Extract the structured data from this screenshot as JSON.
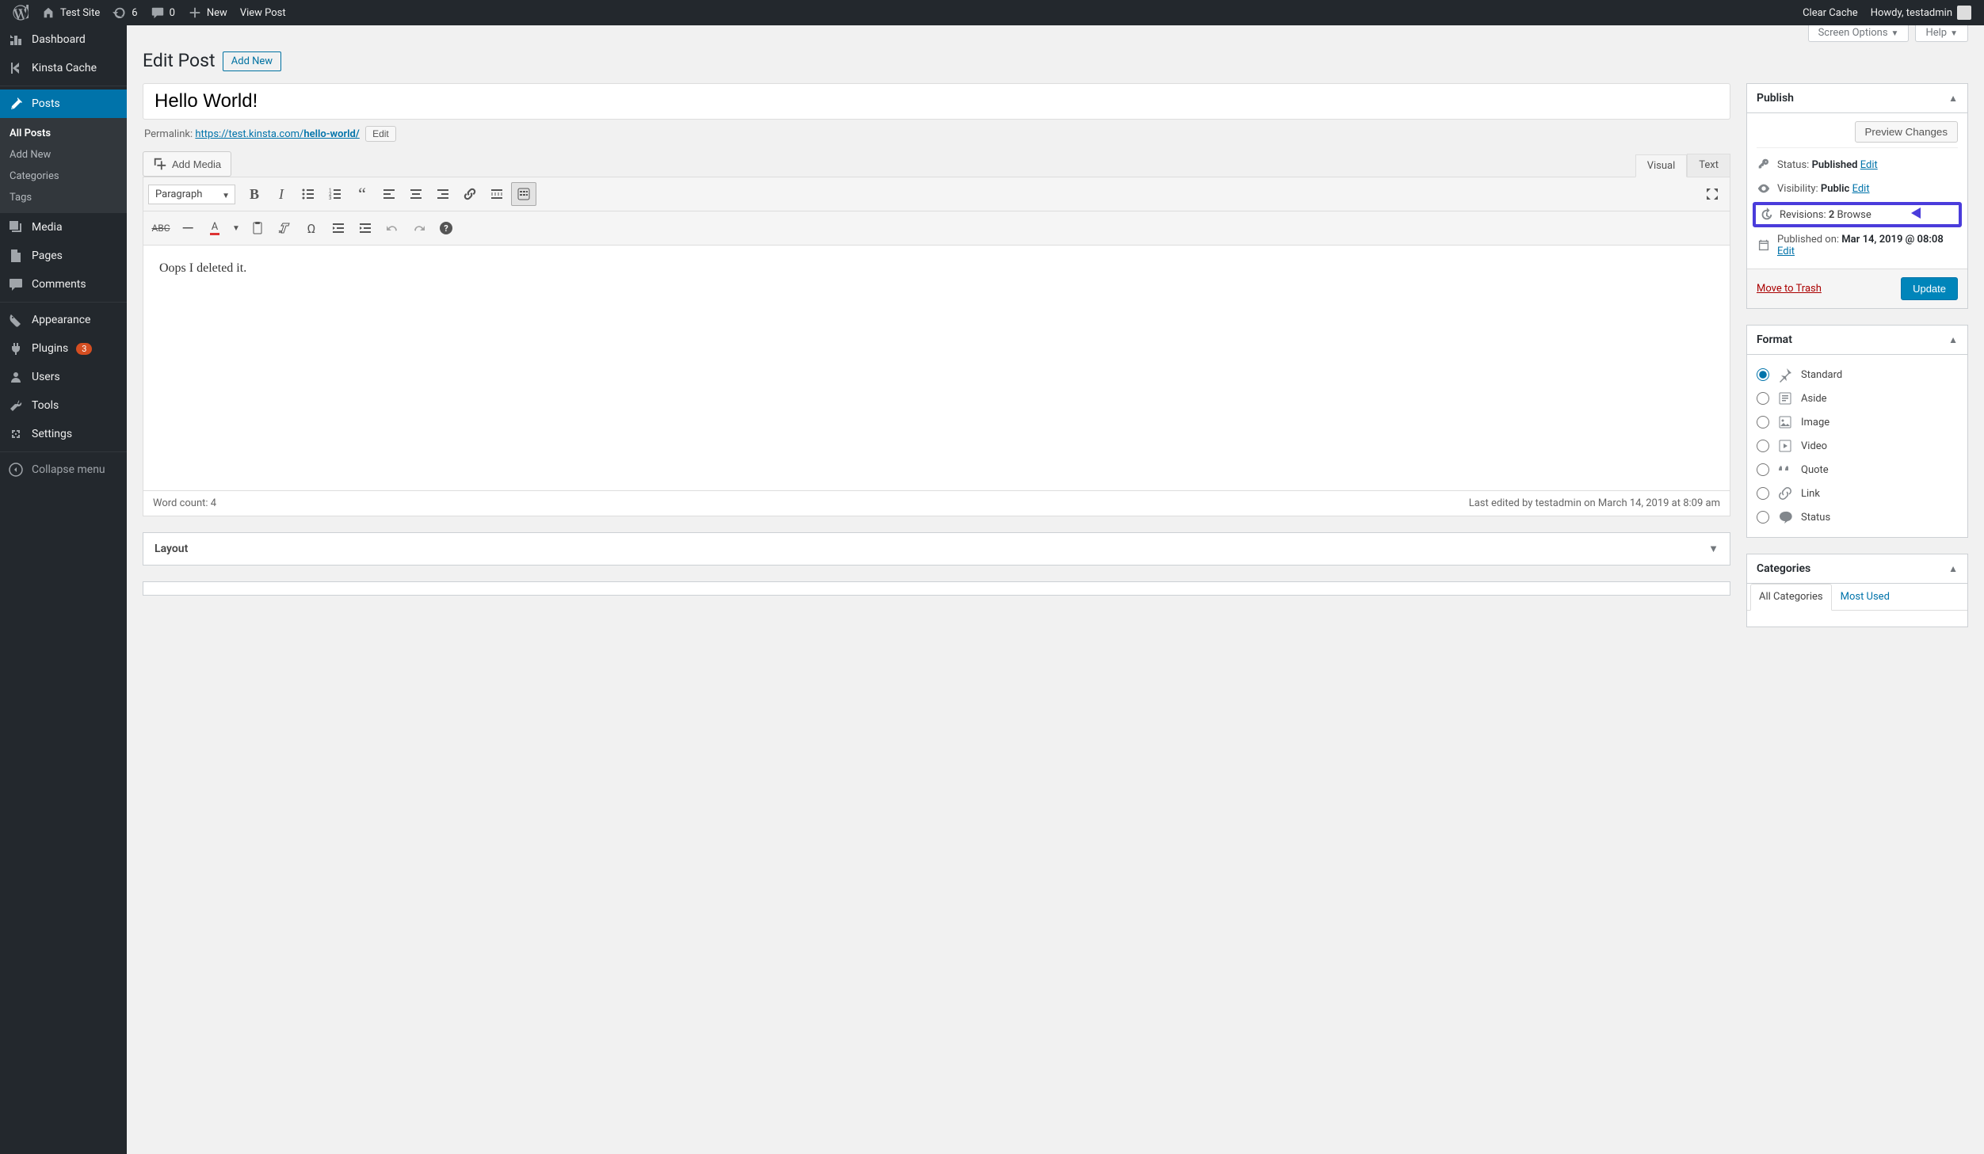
{
  "adminbar": {
    "site_name": "Test Site",
    "updates_count": "6",
    "comments_count": "0",
    "new_label": "New",
    "view_post": "View Post",
    "clear_cache": "Clear Cache",
    "howdy": "Howdy, testadmin"
  },
  "sidebar": {
    "dashboard": "Dashboard",
    "kinsta": "Kinsta Cache",
    "posts": "Posts",
    "posts_sub": {
      "all": "All Posts",
      "add": "Add New",
      "cats": "Categories",
      "tags": "Tags"
    },
    "media": "Media",
    "pages": "Pages",
    "comments": "Comments",
    "appearance": "Appearance",
    "plugins": "Plugins",
    "plugins_badge": "3",
    "users": "Users",
    "tools": "Tools",
    "settings": "Settings",
    "collapse": "Collapse menu"
  },
  "screen_meta": {
    "screen_options": "Screen Options",
    "help": "Help"
  },
  "header": {
    "title": "Edit Post",
    "add_new": "Add New"
  },
  "post": {
    "title_value": "Hello World!",
    "permalink_label": "Permalink:",
    "permalink_base": "https://test.kinsta.com/",
    "permalink_slug": "hello-world/",
    "edit_btn": "Edit",
    "add_media": "Add Media",
    "visual_tab": "Visual",
    "text_tab": "Text",
    "format_select": "Paragraph",
    "body": "Oops I deleted it.",
    "word_count_label": "Word count: ",
    "word_count": "4",
    "last_edited": "Last edited by testadmin on March 14, 2019 at 8:09 am"
  },
  "publish": {
    "box_title": "Publish",
    "preview": "Preview Changes",
    "status_label": "Status:",
    "status_value": "Published",
    "edit": "Edit",
    "visibility_label": "Visibility:",
    "visibility_value": "Public",
    "revisions_label": "Revisions:",
    "revisions_count": "2",
    "browse": "Browse",
    "published_label": "Published on:",
    "published_value": "Mar 14, 2019 @ 08:08",
    "trash": "Move to Trash",
    "update": "Update"
  },
  "format": {
    "box_title": "Format",
    "standard": "Standard",
    "aside": "Aside",
    "image": "Image",
    "video": "Video",
    "quote": "Quote",
    "link": "Link",
    "status": "Status"
  },
  "categories": {
    "box_title": "Categories",
    "all_tab": "All Categories",
    "most_used": "Most Used"
  },
  "layout_meta": {
    "title": "Layout"
  }
}
